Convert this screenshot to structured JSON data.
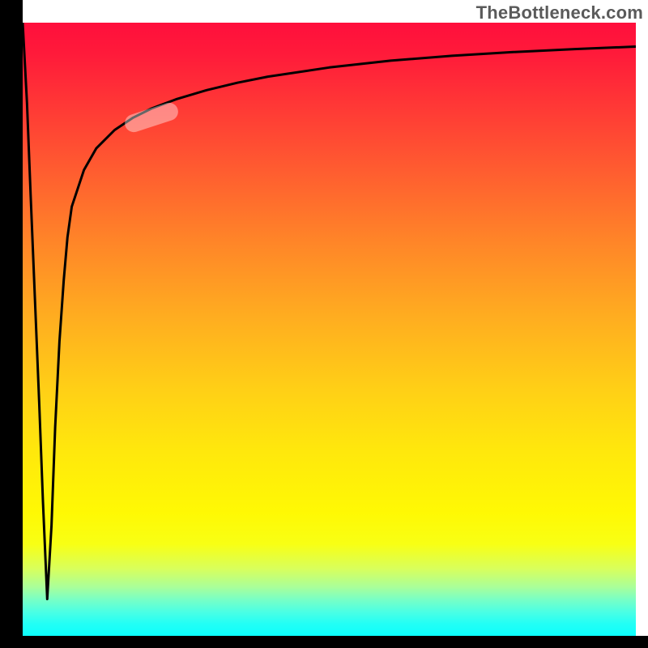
{
  "watermark": "TheBottleneck.com",
  "colors": {
    "axis": "#000000",
    "marker_fill": "rgba(255,255,255,0.40)",
    "curve": "#000000"
  },
  "marker": {
    "x_percent": 21.0,
    "y_percent": 15.5,
    "angle_deg": -18
  },
  "chart_data": {
    "type": "line",
    "title": "",
    "xlabel": "",
    "ylabel": "",
    "xlim": [
      0,
      100
    ],
    "ylim": [
      0,
      100
    ],
    "description": "Spike-plus-log-like curve on a red→yellow→green vertical gradient background. A single highlighted segment (rounded marker) sits on the curve near the upper-left knee.",
    "series": [
      {
        "name": "curve",
        "x": [
          0,
          0.7,
          1.3,
          2,
          2.7,
          3.3,
          4,
          4.7,
          5.3,
          6,
          6.7,
          7.3,
          8,
          10,
          12,
          15,
          18,
          21,
          25,
          30,
          35,
          40,
          50,
          60,
          70,
          80,
          90,
          100
        ],
        "y": [
          100,
          87,
          72,
          55,
          38,
          22,
          6,
          18,
          34,
          48,
          58,
          65,
          70,
          76,
          79.5,
          82.5,
          84.5,
          86,
          87.5,
          89,
          90.2,
          91.2,
          92.7,
          93.8,
          94.6,
          95.2,
          95.7,
          96.1
        ]
      }
    ],
    "highlight_segment": {
      "series": "curve",
      "x_start": 17,
      "x_end": 25
    }
  }
}
